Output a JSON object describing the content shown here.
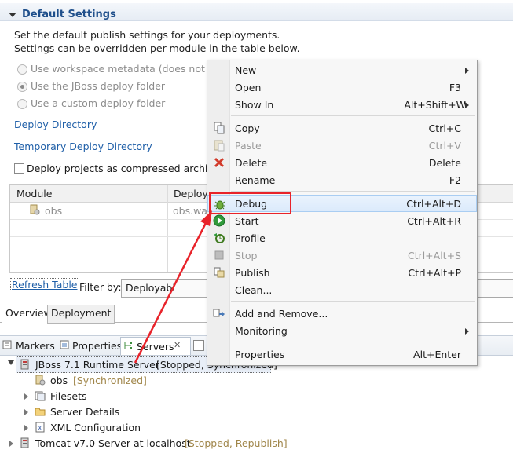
{
  "section": {
    "title": "Default Settings",
    "desc_line1": "Set the default publish settings for your deployments.",
    "desc_line2": "Settings can be overridden per-module in the table below."
  },
  "options": {
    "radio1": "Use workspace metadata (does not mo",
    "radio2": "Use the JBoss deploy folder",
    "radio3": "Use a custom deploy folder",
    "deploy_directory": "Deploy Directory",
    "temp_deploy_directory": "Temporary Deploy Directory",
    "compressed": "Deploy projects as compressed archive"
  },
  "table": {
    "col_module": "Module",
    "col_deploy": "Deploym",
    "row_module": "obs",
    "row_deploy": "obs.war"
  },
  "controls": {
    "refresh": "Refresh Table",
    "filter_label": "Filter by:",
    "filter_value": "Deployabl"
  },
  "editor_tabs": {
    "overview": "Overview",
    "deployment": "Deployment"
  },
  "views": {
    "markers": "Markers",
    "properties": "Properties",
    "servers": "Servers"
  },
  "tree": {
    "server1": "JBoss 7.1 Runtime Server",
    "server1_status": "[Stopped, Synchronized]",
    "module": "obs",
    "module_status": "[Synchronized]",
    "filesets": "Filesets",
    "server_details": "Server Details",
    "xml_config": "XML Configuration",
    "server2": "Tomcat v7.0 Server at localhost",
    "server2_status": "[Stopped, Republish]"
  },
  "menu": {
    "new": "New",
    "open": "Open",
    "open_sc": "F3",
    "show_in": "Show In",
    "show_in_sc": "Alt+Shift+W",
    "copy": "Copy",
    "copy_sc": "Ctrl+C",
    "paste": "Paste",
    "paste_sc": "Ctrl+V",
    "delete": "Delete",
    "delete_sc": "Delete",
    "rename": "Rename",
    "rename_sc": "F2",
    "debug": "Debug",
    "debug_sc": "Ctrl+Alt+D",
    "start": "Start",
    "start_sc": "Ctrl+Alt+R",
    "profile": "Profile",
    "stop": "Stop",
    "stop_sc": "Ctrl+Alt+S",
    "publish": "Publish",
    "publish_sc": "Ctrl+Alt+P",
    "clean": "Clean...",
    "add_remove": "Add and Remove...",
    "monitoring": "Monitoring",
    "properties": "Properties",
    "properties_sc": "Alt+Enter"
  },
  "colors": {
    "highlight_box": "#e8232a",
    "arrow": "#e8232a",
    "link": "#1f5fa8"
  }
}
